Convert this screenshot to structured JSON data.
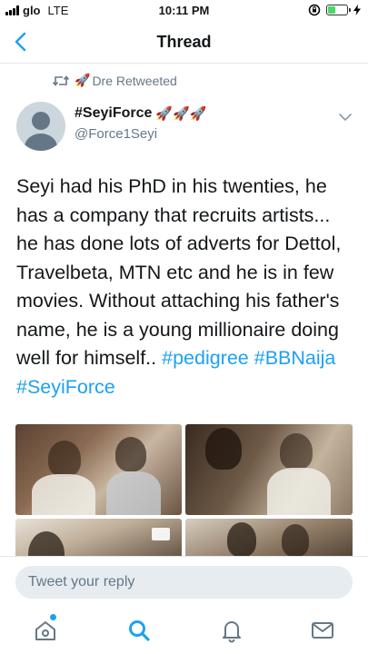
{
  "status_bar": {
    "carrier": "glo",
    "network": "LTE",
    "time": "10:11 PM",
    "battery_color": "#4cd964"
  },
  "nav": {
    "title": "Thread",
    "back_icon": "chevron-left-icon"
  },
  "retweet": {
    "emoji": "🚀",
    "label": "Dre Retweeted"
  },
  "tweet": {
    "display_name": "#SeyiForce",
    "name_emojis": "🚀🚀🚀",
    "handle": "@Force1Seyi",
    "text": "Seyi had his PhD in his twenties, he has a company that recruits artists... he has done lots of adverts for Dettol, Travelbeta, MTN etc and he is in few movies. Without attaching his father's name, he is a young millionaire doing well for himself.. ",
    "hashtag_1": "#pedigree",
    "hashtag_2": "#BBNaija",
    "hashtag_3": "#SeyiForce",
    "photo_count": 4
  },
  "reply": {
    "placeholder": "Tweet your reply"
  },
  "tabs": [
    {
      "name": "home",
      "icon": "home-icon",
      "has_badge": true
    },
    {
      "name": "search",
      "icon": "search-icon",
      "active": true
    },
    {
      "name": "notifications",
      "icon": "bell-icon"
    },
    {
      "name": "messages",
      "icon": "mail-icon"
    }
  ],
  "colors": {
    "accent": "#1da1f2",
    "muted": "#657786",
    "text": "#14171a",
    "input_bg": "#e6ecf0"
  }
}
